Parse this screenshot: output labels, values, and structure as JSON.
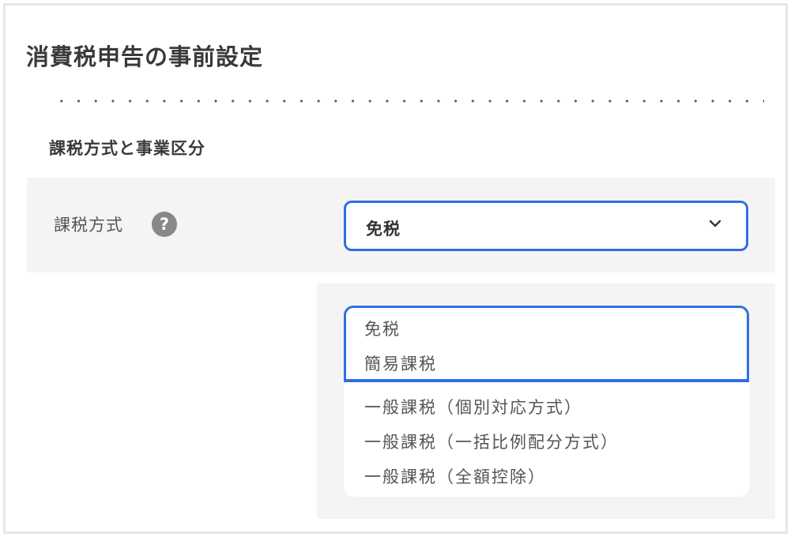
{
  "page_title": "消費税申告の事前設定",
  "section_title": "課税方式と事業区分",
  "field": {
    "label": "課税方式",
    "help_icon": "?",
    "selected_value": "免税",
    "chevron_icon": "chevron-down-icon"
  },
  "dropdown": {
    "options": [
      "免税",
      "簡易課税",
      "一般課税（個別対応方式）",
      "一般課税（一括比例配分方式）",
      "一般課税（全額控除）"
    ]
  },
  "colors": {
    "accent": "#2f6fe4",
    "panel_bg": "#f5f3f3",
    "help_icon_bg": "#888888"
  }
}
